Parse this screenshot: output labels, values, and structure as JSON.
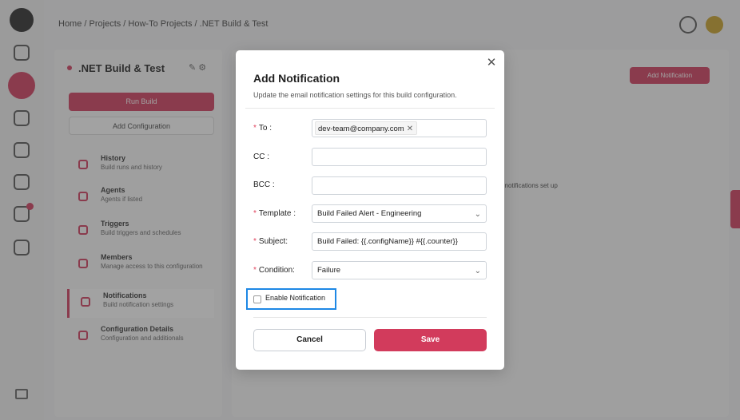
{
  "background": {
    "breadcrumb": "Home / Projects / How-To Projects / .NET Build & Test",
    "project_title": ".NET Build & Test",
    "run_build_label": "Run Build",
    "add_configuration_label": "Add Configuration",
    "nav_items": [
      {
        "title": "History",
        "desc": "Build runs and history"
      },
      {
        "title": "Agents",
        "desc": "Agents if listed"
      },
      {
        "title": "Triggers",
        "desc": "Build triggers and schedules"
      },
      {
        "title": "Members",
        "desc": "Manage access to this configuration"
      },
      {
        "title": "Notifications",
        "desc": "Build notification settings"
      },
      {
        "title": "Configuration Details",
        "desc": "Configuration and additionals"
      }
    ],
    "add_notification_label": "Add Notification",
    "hint_text": "for notifications set up"
  },
  "modal": {
    "title": "Add Notification",
    "subtitle": "Update the email notification settings for this build configuration.",
    "close_glyph": "✕",
    "fields": {
      "to": {
        "label": "To",
        "tag_value": "dev-team@company.com",
        "tag_remove": "✕"
      },
      "cc": {
        "label": "CC",
        "value": ""
      },
      "bcc": {
        "label": "BCC",
        "value": ""
      },
      "template": {
        "label": "Template",
        "value": "Build Failed Alert - Engineering"
      },
      "subject": {
        "label": "Subject",
        "value": "Build Failed: {{.configName}} #{{.counter}}"
      },
      "condition": {
        "label": "Condition",
        "value": "Failure"
      }
    },
    "required_mark": "*",
    "colon": ":",
    "enable_notification": {
      "label": "Enable Notification",
      "checked": false
    },
    "buttons": {
      "cancel": "Cancel",
      "save": "Save"
    }
  },
  "colors": {
    "accent": "#d23b5c",
    "focus_outline": "#1e88e5"
  }
}
